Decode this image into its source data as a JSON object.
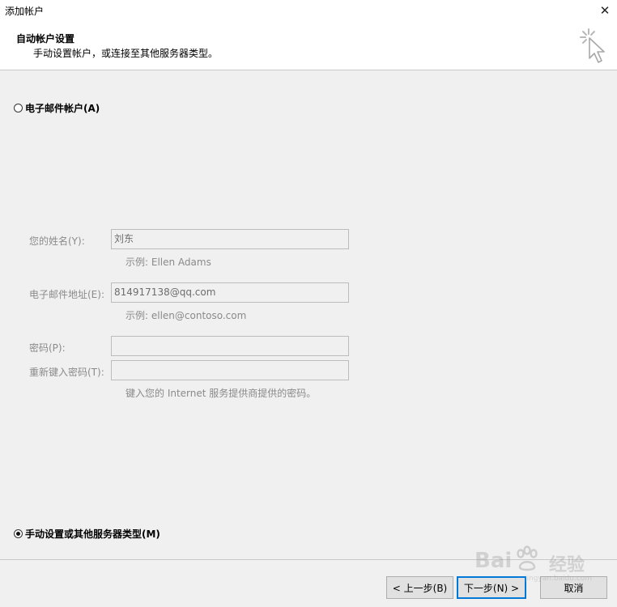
{
  "window": {
    "title": "添加帐户",
    "close_glyph": "✕"
  },
  "header": {
    "title": "自动帐户设置",
    "subtitle": "手动设置帐户，或连接至其他服务器类型。",
    "icon": "wizard-cursor-icon"
  },
  "options": {
    "email_account": {
      "label": "电子邮件帐户(A)",
      "checked": false
    },
    "manual_setup": {
      "label": "手动设置或其他服务器类型(M)",
      "checked": true
    }
  },
  "form": {
    "name": {
      "label": "您的姓名(Y):",
      "value": "刘东",
      "hint": "示例: Ellen Adams"
    },
    "email": {
      "label": "电子邮件地址(E):",
      "value": "814917138@qq.com",
      "hint": "示例: ellen@contoso.com"
    },
    "password": {
      "label": "密码(P):",
      "value": ""
    },
    "retype_password": {
      "label": "重新键入密码(T):",
      "value": ""
    },
    "password_hint": "键入您的 Internet 服务提供商提供的密码。"
  },
  "buttons": {
    "back": "< 上一步(B)",
    "next": "下一步(N) >",
    "cancel": "取消"
  },
  "watermark": {
    "brand": "Bai",
    "cn": "经验",
    "url": "jingyan.baidu.com"
  },
  "colors": {
    "accent": "#0078d7",
    "disabled_text": "#8a8a8a"
  }
}
